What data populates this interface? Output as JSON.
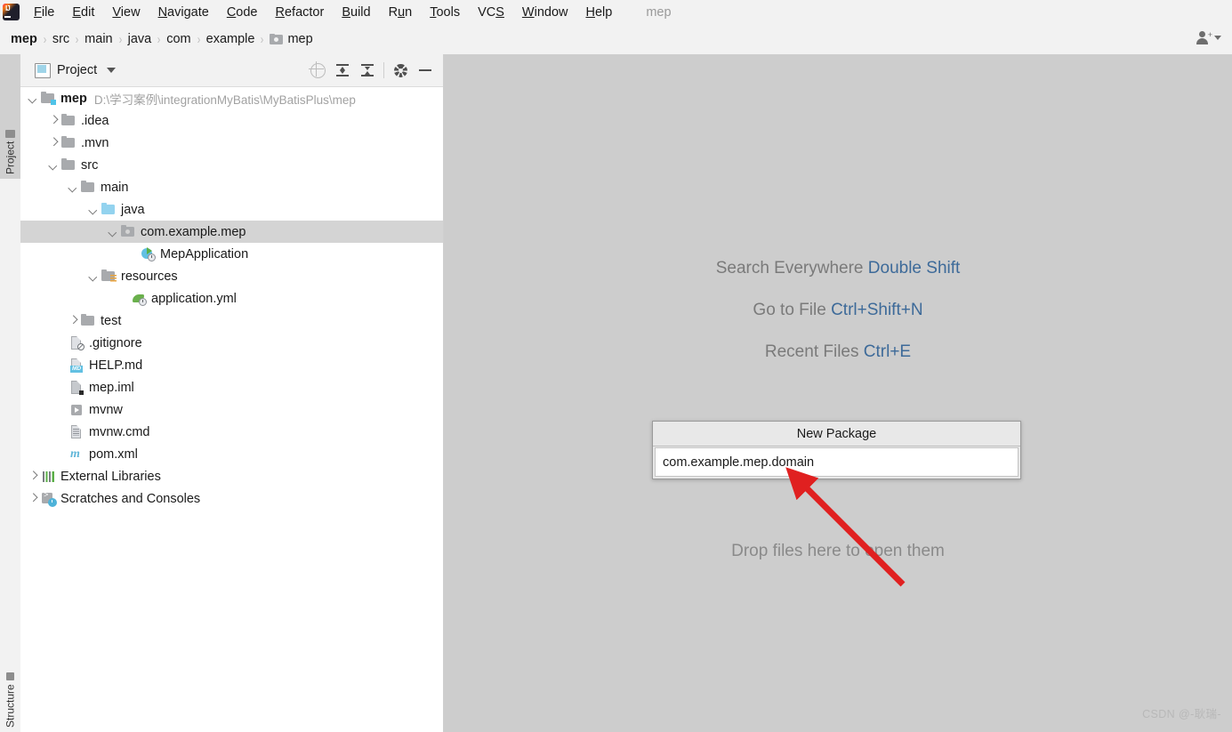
{
  "app": {
    "logo_icon": "intellij-idea-logo",
    "project_label": "mep"
  },
  "menubar": {
    "items": [
      {
        "label": "File",
        "mnemonic": "F"
      },
      {
        "label": "Edit",
        "mnemonic": "E"
      },
      {
        "label": "View",
        "mnemonic": "V"
      },
      {
        "label": "Navigate",
        "mnemonic": "N"
      },
      {
        "label": "Code",
        "mnemonic": "C"
      },
      {
        "label": "Refactor",
        "mnemonic": "R"
      },
      {
        "label": "Build",
        "mnemonic": "B"
      },
      {
        "label": "Run",
        "mnemonic": "u"
      },
      {
        "label": "Tools",
        "mnemonic": "T"
      },
      {
        "label": "VCS",
        "mnemonic": "S"
      },
      {
        "label": "Window",
        "mnemonic": "W"
      },
      {
        "label": "Help",
        "mnemonic": "H"
      }
    ]
  },
  "navbar": {
    "crumbs": [
      "mep",
      "src",
      "main",
      "java",
      "com",
      "example",
      "mep"
    ],
    "separator": "›",
    "account_icon": "user-account-icon"
  },
  "toolstrip": {
    "top_tab": "Project",
    "bottom_tab": "Structure"
  },
  "project_panel": {
    "title": "Project",
    "icons": [
      "locate-target-icon",
      "expand-all-icon",
      "collapse-all-icon",
      "settings-gear-icon",
      "hide-panel-icon"
    ],
    "tree": [
      {
        "label": "mep",
        "path": "D:\\学习案例\\integrationMyBatis\\MyBatisPlus\\mep",
        "indent": 0,
        "twisty": "down",
        "icon": "module-folder",
        "bold": true,
        "selected": false
      },
      {
        "label": ".idea",
        "path": "",
        "indent": 1,
        "twisty": "right",
        "icon": "folder",
        "bold": false,
        "selected": false
      },
      {
        "label": ".mvn",
        "path": "",
        "indent": 1,
        "twisty": "right",
        "icon": "folder",
        "bold": false,
        "selected": false
      },
      {
        "label": "src",
        "path": "",
        "indent": 1,
        "twisty": "down",
        "icon": "folder",
        "bold": false,
        "selected": false
      },
      {
        "label": "main",
        "path": "",
        "indent": 2,
        "twisty": "down",
        "icon": "folder",
        "bold": false,
        "selected": false
      },
      {
        "label": "java",
        "path": "",
        "indent": 3,
        "twisty": "down",
        "icon": "source-folder",
        "bold": false,
        "selected": false
      },
      {
        "label": "com.example.mep",
        "path": "",
        "indent": 4,
        "twisty": "down",
        "icon": "package",
        "bold": false,
        "selected": true
      },
      {
        "label": "MepApplication",
        "path": "",
        "indent": 5,
        "twisty": "none",
        "icon": "spring-boot-class",
        "bold": false,
        "selected": false
      },
      {
        "label": "resources",
        "path": "",
        "indent": 3,
        "twisty": "down",
        "icon": "resources-folder",
        "bold": false,
        "selected": false
      },
      {
        "label": "application.yml",
        "path": "",
        "indent": 4,
        "twisty": "none",
        "icon": "spring-yaml",
        "bold": false,
        "selected": false
      },
      {
        "label": "test",
        "path": "",
        "indent": 2,
        "twisty": "right",
        "icon": "folder",
        "bold": false,
        "selected": false
      },
      {
        "label": ".gitignore",
        "path": "",
        "indent": 2,
        "twisty": "none",
        "icon": "gitignore-file",
        "bold": false,
        "selected": false
      },
      {
        "label": "HELP.md",
        "path": "",
        "indent": 2,
        "twisty": "none",
        "icon": "markdown-file",
        "bold": false,
        "selected": false
      },
      {
        "label": "mep.iml",
        "path": "",
        "indent": 2,
        "twisty": "none",
        "icon": "iml-file",
        "bold": false,
        "selected": false
      },
      {
        "label": "mvnw",
        "path": "",
        "indent": 2,
        "twisty": "none",
        "icon": "shell-script-file",
        "bold": false,
        "selected": false
      },
      {
        "label": "mvnw.cmd",
        "path": "",
        "indent": 2,
        "twisty": "none",
        "icon": "cmd-file",
        "bold": false,
        "selected": false
      },
      {
        "label": "pom.xml",
        "path": "",
        "indent": 2,
        "twisty": "none",
        "icon": "maven-pom-file",
        "bold": false,
        "selected": false
      },
      {
        "label": "External Libraries",
        "path": "",
        "indent": 0,
        "twisty": "right",
        "icon": "libraries",
        "bold": false,
        "selected": false
      },
      {
        "label": "Scratches and Consoles",
        "path": "",
        "indent": 0,
        "twisty": "right",
        "icon": "scratches",
        "bold": false,
        "selected": false
      }
    ]
  },
  "editor": {
    "hints": [
      {
        "action": "Search Everywhere",
        "shortcut": "Double Shift"
      },
      {
        "action": "Go to File",
        "shortcut": "Ctrl+Shift+N"
      },
      {
        "action": "Recent Files",
        "shortcut": "Ctrl+E"
      }
    ],
    "drop_text": "Drop files here to open them",
    "watermark": "CSDN @-耿瑞-"
  },
  "dialog": {
    "title": "New Package",
    "input_value": "com.example.mep.domain",
    "input_placeholder": ""
  },
  "annotation": {
    "arrow_color": "#e02020",
    "arrow_name": "red-pointer-arrow"
  },
  "colors": {
    "menu_bg": "#f2f2f2",
    "panel_bg": "#ffffff",
    "editor_bg": "#cdcdcd",
    "selection": "#d4d4d4",
    "link_blue": "#3d6a99",
    "hint_gray": "#7a7a7a"
  }
}
